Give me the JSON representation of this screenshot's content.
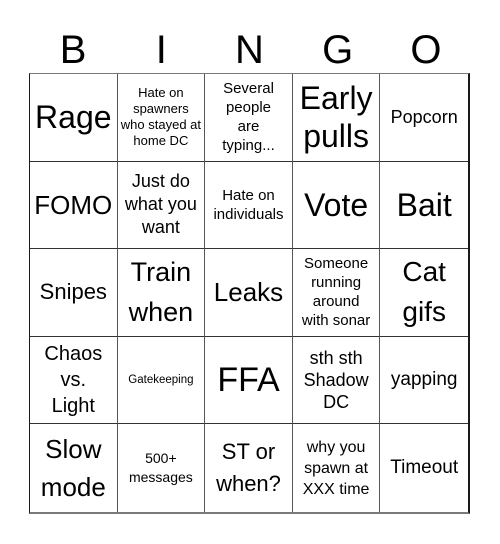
{
  "header": {
    "letters": [
      "B",
      "I",
      "N",
      "G",
      "O"
    ]
  },
  "cells": [
    [
      "Rage",
      "Hate on spawners who stayed at home DC",
      "Several people are typing...",
      "Early pulls",
      "Popcorn"
    ],
    [
      "FOMO",
      "Just do what you want",
      "Hate on individuals",
      "Vote",
      "Bait"
    ],
    [
      "Snipes",
      "Train when",
      "Leaks",
      "Someone running around with sonar",
      "Cat gifs"
    ],
    [
      "Chaos vs. Light",
      "Gatekeeping",
      "FFA",
      "sth sth Shadow DC",
      "yapping"
    ],
    [
      "Slow mode",
      "500+ messages",
      "ST or when?",
      "why you spawn at XXX time",
      "Timeout"
    ]
  ]
}
